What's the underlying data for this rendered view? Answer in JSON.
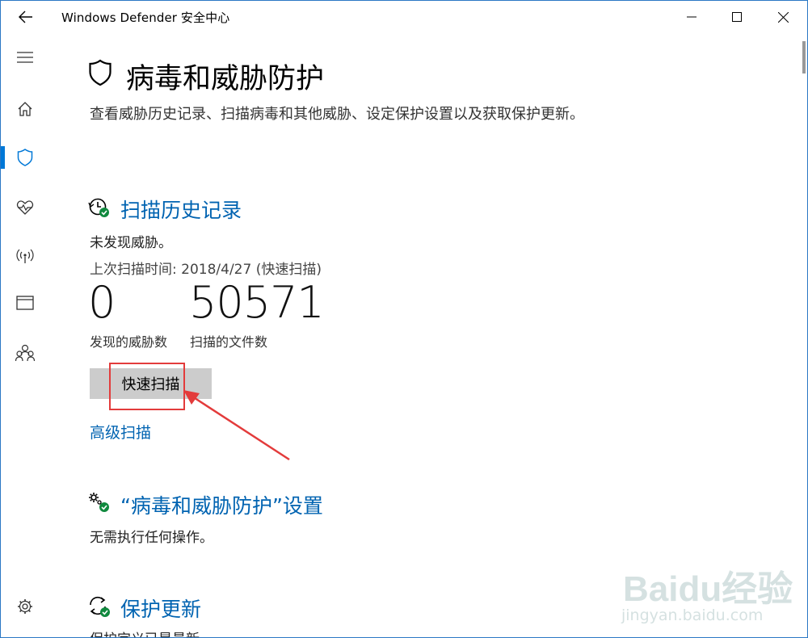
{
  "window": {
    "title": "Windows Defender 安全中心"
  },
  "sidebar": {
    "items": [
      {
        "icon": "hamburger-menu-icon"
      },
      {
        "icon": "home-icon"
      },
      {
        "icon": "shield-icon",
        "selected": true
      },
      {
        "icon": "heart-pulse-icon"
      },
      {
        "icon": "wireless-icon"
      },
      {
        "icon": "browser-window-icon"
      },
      {
        "icon": "family-icon"
      },
      {
        "icon": "gear-icon"
      }
    ]
  },
  "page": {
    "title": "病毒和威胁防护",
    "description": "查看威胁历史记录、扫描病毒和其他威胁、设定保护设置以及获取保护更新。"
  },
  "scan_history": {
    "heading": "扫描历史记录",
    "status": "未发现威胁。",
    "last_scan": "上次扫描时间: 2018/4/27 (快速扫描)",
    "threats_found": "0",
    "threats_found_label": "发现的威胁数",
    "files_scanned": "50571",
    "files_scanned_label": "扫描的文件数",
    "quick_scan_label": "快速扫描",
    "advanced_scan_label": "高级扫描"
  },
  "settings": {
    "heading": "“病毒和威胁防护”设置",
    "status": "无需执行任何操作。"
  },
  "updates": {
    "heading": "保护更新",
    "status": "保护定义已是最新"
  },
  "watermark": {
    "logo": "Baidu经验",
    "url": "jingyan.baidu.com"
  },
  "colors": {
    "accent": "#0078d7",
    "link": "#0063b1",
    "highlight": "#e33b3b",
    "button_bg": "#cccccc",
    "ok_green": "#10893e"
  }
}
